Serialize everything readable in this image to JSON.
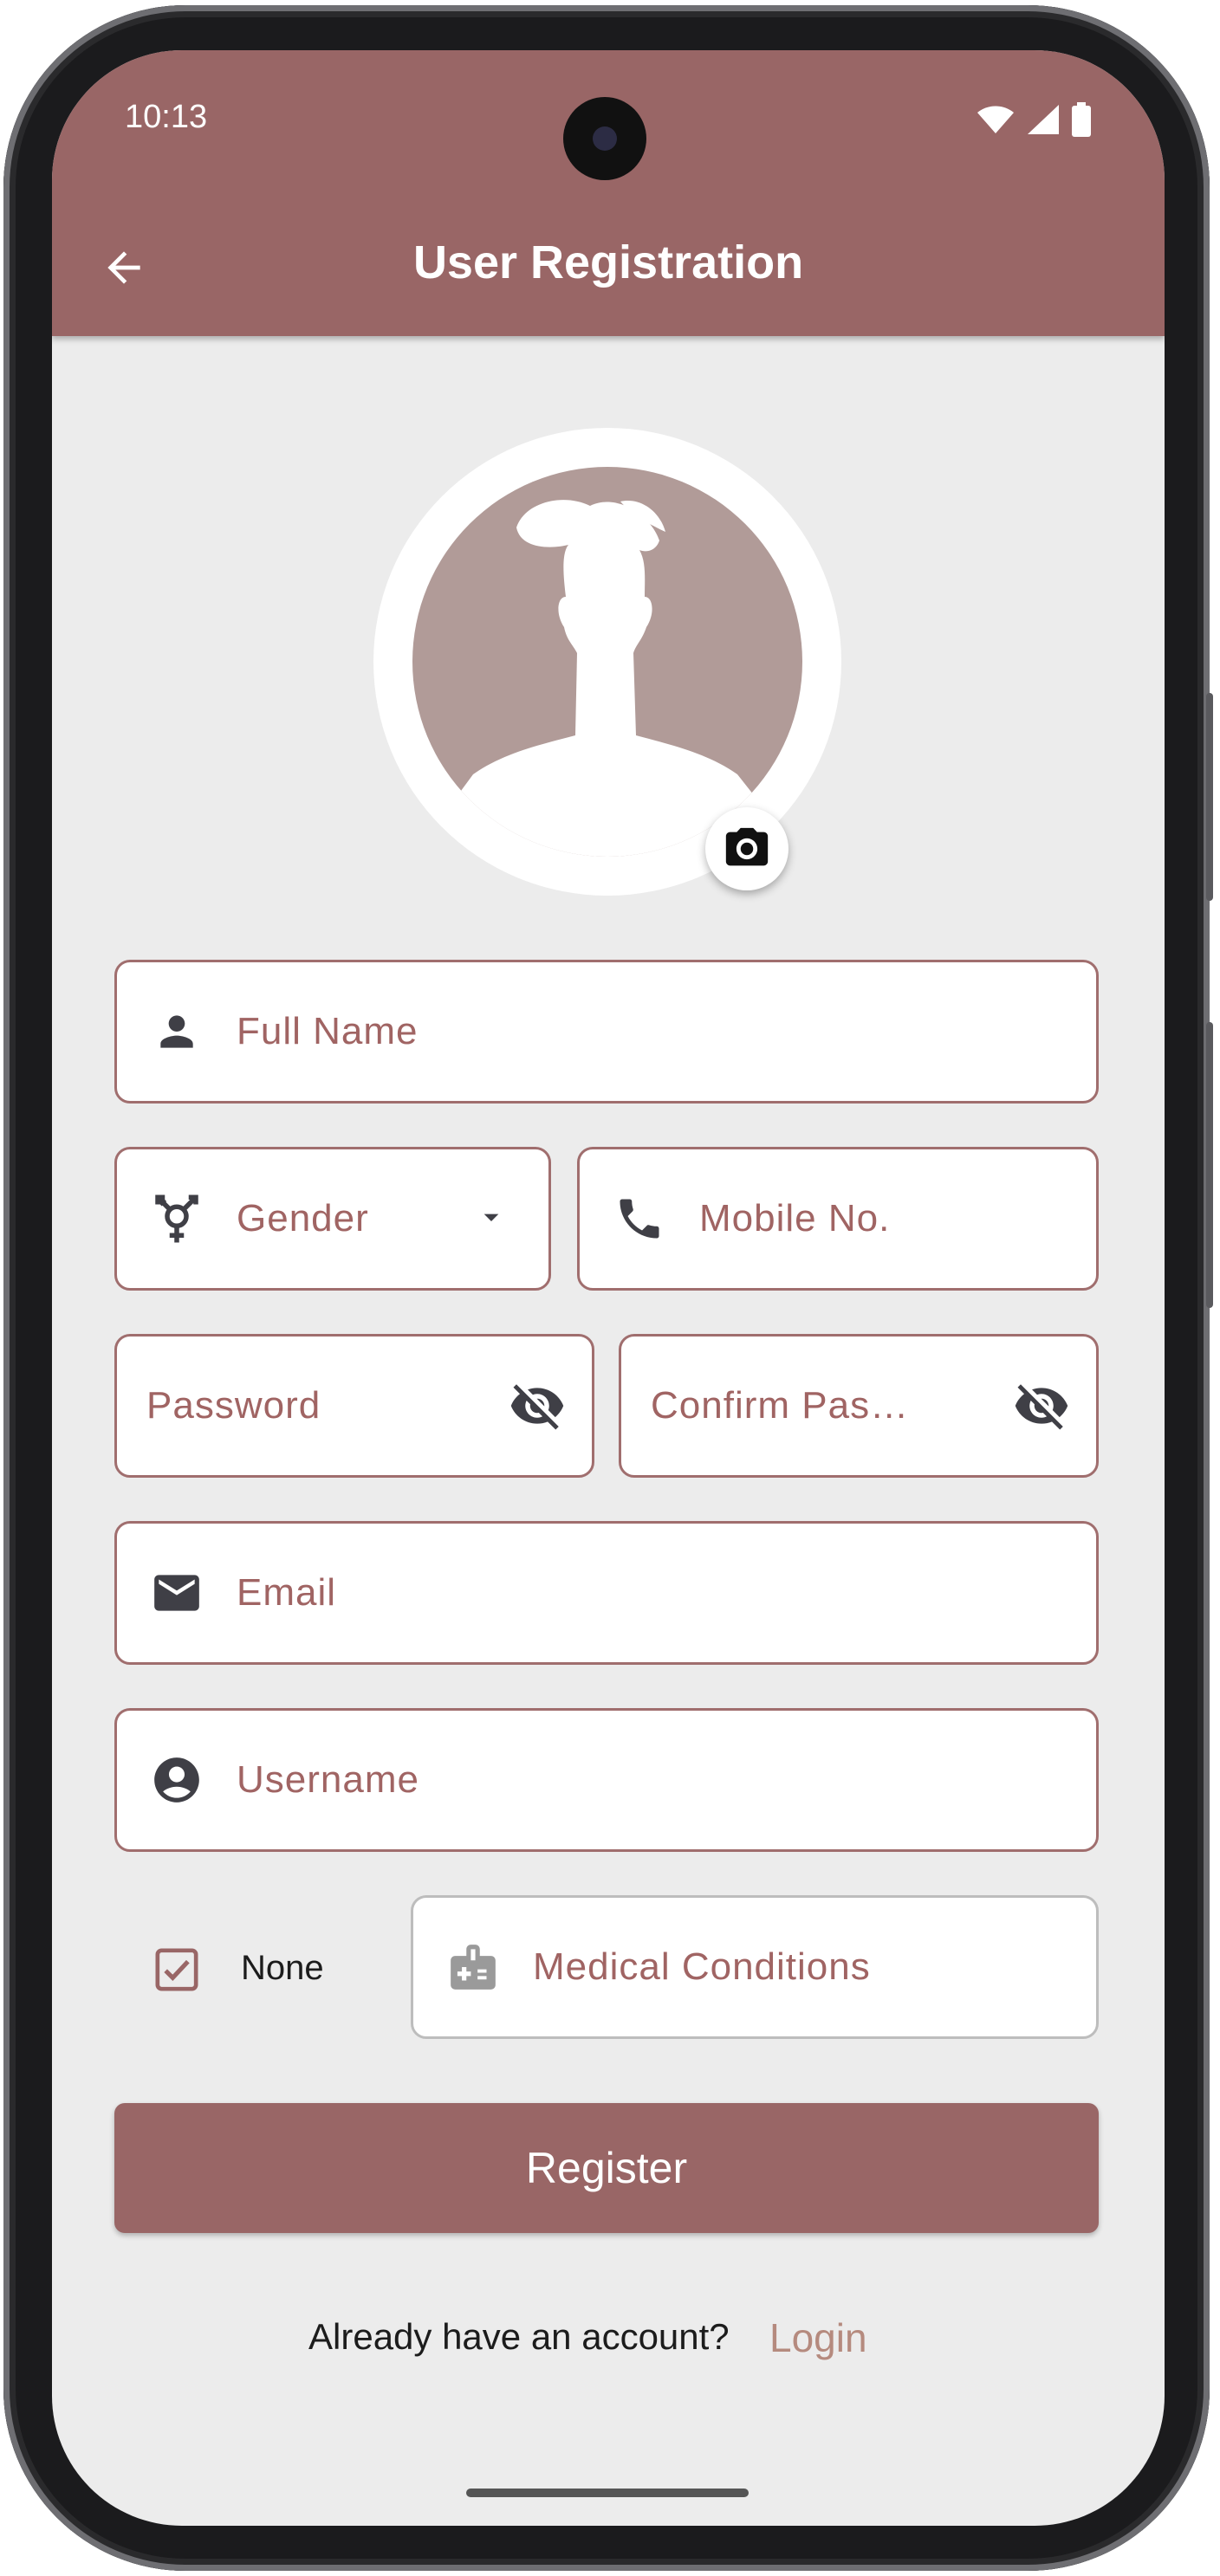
{
  "status": {
    "time": "10:13"
  },
  "appbar": {
    "title": "User Registration",
    "back_icon": "arrow-back-icon"
  },
  "colors": {
    "primary": "#996666",
    "field_border": "#a06e6e",
    "placeholder": "#a06463",
    "link": "#b58a7e",
    "background": "#ececec"
  },
  "form": {
    "full_name": {
      "placeholder": "Full Name",
      "icon": "person-icon"
    },
    "gender": {
      "placeholder": "Gender",
      "icon": "transgender-icon"
    },
    "mobile": {
      "placeholder": "Mobile No.",
      "icon": "phone-icon"
    },
    "password": {
      "placeholder": "Password",
      "icon": "visibility-off-icon"
    },
    "confirm_password": {
      "placeholder": "Confirm Pas…",
      "icon": "visibility-off-icon"
    },
    "email": {
      "placeholder": "Email",
      "icon": "email-icon"
    },
    "username": {
      "placeholder": "Username",
      "icon": "account-circle-icon"
    },
    "none_checkbox": {
      "label": "None",
      "checked": true
    },
    "medical_conditions": {
      "placeholder": "Medical Conditions",
      "icon": "medical-id-icon"
    }
  },
  "register_button": {
    "label": "Register"
  },
  "footer": {
    "prompt": "Already have an account?",
    "login_link": "Login"
  }
}
